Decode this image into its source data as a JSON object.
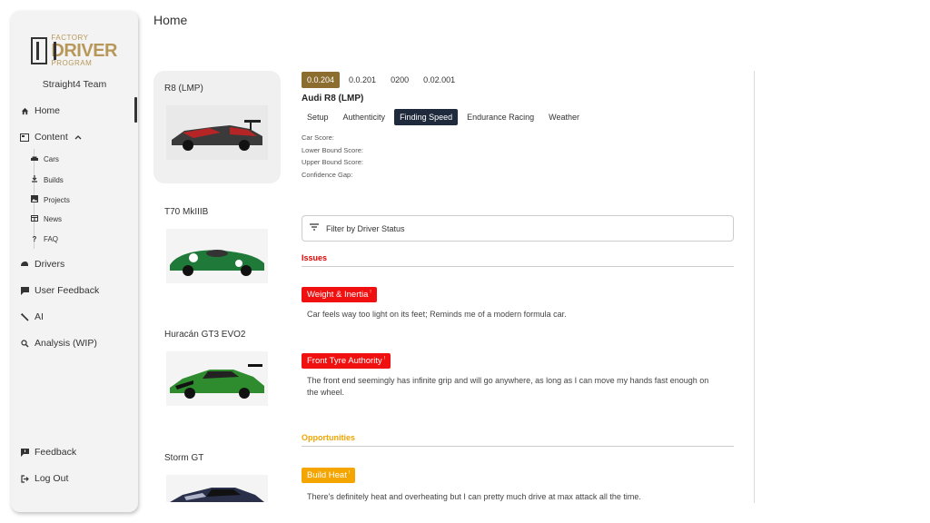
{
  "sidebar": {
    "logo": {
      "factory": "FACTORY",
      "driver": "DRIVER",
      "program": "PROGRAM"
    },
    "team": "Straight4 Team",
    "items": [
      {
        "label": "Home",
        "icon": "home-icon"
      },
      {
        "label": "Content",
        "icon": "content-icon"
      },
      {
        "label": "Drivers",
        "icon": "helmet-icon"
      },
      {
        "label": "User Feedback",
        "icon": "comment-icon"
      },
      {
        "label": "AI",
        "icon": "wrench-icon"
      },
      {
        "label": "Analysis (WIP)",
        "icon": "search-icon"
      }
    ],
    "content_sub": [
      {
        "label": "Cars",
        "icon": "car-icon"
      },
      {
        "label": "Builds",
        "icon": "download-icon"
      },
      {
        "label": "Projects",
        "icon": "image-icon"
      },
      {
        "label": "News",
        "icon": "news-icon"
      },
      {
        "label": "FAQ",
        "icon": "question-icon"
      }
    ],
    "bottom": [
      {
        "label": "Feedback",
        "icon": "feedback-icon"
      },
      {
        "label": "Log Out",
        "icon": "logout-icon"
      }
    ]
  },
  "page": {
    "title": "Home"
  },
  "cars": [
    {
      "name": "R8 (LMP)",
      "color": "#7a1f1f",
      "selected": true
    },
    {
      "name": "T70 MkIIIB",
      "color": "#1f7a3a"
    },
    {
      "name": "Huracán GT3 EVO2",
      "color": "#2e8b2e"
    },
    {
      "name": "Storm GT",
      "color": "#2a2f4a"
    }
  ],
  "detail": {
    "versions": [
      "0.0.204",
      "0.0.201",
      "0200",
      "0.02.001"
    ],
    "active_version": "0.0.204",
    "car_title": "Audi R8 (LMP)",
    "tabs": [
      "Setup",
      "Authenticity",
      "Finding Speed",
      "Endurance Racing",
      "Weather"
    ],
    "active_tab": "Finding Speed",
    "scores": [
      "Car Score:",
      "Lower Bound Score:",
      "Upper Bound Score:",
      "Confidence Gap:"
    ],
    "filter_label": "Filter by Driver Status",
    "issues_heading": "Issues",
    "issues": [
      {
        "tag": "Weight & Inertia",
        "text": "Car feels way too light on its feet; Reminds me of a modern formula car."
      },
      {
        "tag": "Front Tyre Authority",
        "text": "The front end seemingly has infinite grip and will go anywhere, as long as I can move my hands fast enough on the wheel."
      }
    ],
    "opportunities_heading": "Opportunities",
    "opportunities": [
      {
        "tag": "Build Heat",
        "text": "There's definitely heat and overheating but I can pretty much drive at max attack all the time."
      }
    ],
    "tag_marker": "!"
  },
  "colors": {
    "gold": "#8a6d2f",
    "navy": "#1f2a3c",
    "issue_red": "#f01010",
    "opportunity_orange": "#f5a500"
  }
}
